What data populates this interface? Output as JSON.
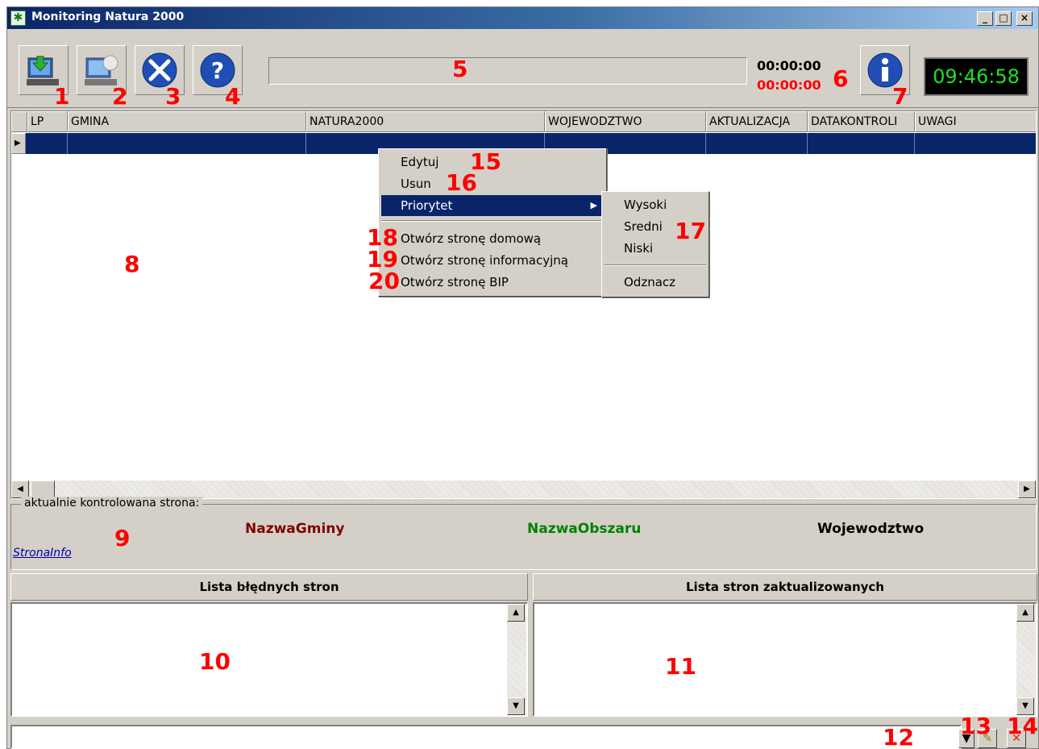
{
  "window": {
    "title": "Monitoring Natura 2000",
    "app_icon": "asterisk-icon",
    "minimize": "_",
    "maximize": "□",
    "close": "×"
  },
  "toolbar": {
    "buttons": [
      {
        "icon": "download-computer-icon",
        "marker": "1"
      },
      {
        "icon": "computer-monitor-icon",
        "marker": "2"
      },
      {
        "icon": "tools-wrench-icon",
        "marker": "3"
      },
      {
        "icon": "help-question-icon",
        "marker": "4"
      }
    ],
    "progress_marker": "5",
    "timer_elapsed": "00:00:00",
    "timer_remaining": "00:00:00",
    "timer_marker": "6",
    "info_button": {
      "icon": "info-icon",
      "marker": "7"
    },
    "clock": "09:46:58",
    "clock_color": "#21e021"
  },
  "grid": {
    "marker": "8",
    "columns": [
      "LP",
      "GMINA",
      "NATURA2000",
      "WOJEWODZTWO",
      "AKTUALIZACJA",
      "DATAKONTROLI",
      "UWAGI"
    ],
    "selected_row_color": "#0a246a",
    "row_indicator": "▶"
  },
  "context_menu": {
    "items": [
      {
        "label": "Edytuj",
        "marker": "15"
      },
      {
        "label": "Usun",
        "marker": "16"
      },
      {
        "label": "Priorytet",
        "marker": ""
      },
      {
        "label": "Otwórz stronę domową",
        "marker": "18"
      },
      {
        "label": "Otwórz stronę informacyjną",
        "marker": "19"
      },
      {
        "label": "Otwórz stronę BIP",
        "marker": "20"
      }
    ],
    "submenu": {
      "items": [
        "Wysoki",
        "Sredni",
        "Niski",
        "Odznacz"
      ],
      "marker": "17"
    }
  },
  "current_site": {
    "legend": "aktualnie kontrolowana strona:",
    "marker": "9",
    "gmina": "NazwaGminy",
    "gmina_color": "#800000",
    "obszar": "NazwaObszaru",
    "obszar_color": "#008000",
    "wojewodztwo": "Wojewodztwo",
    "link": "StronaInfo"
  },
  "lists": {
    "errors_title": "Lista błędnych stron",
    "errors_marker": "10",
    "updated_title": "Lista stron zaktualizowanych",
    "updated_marker": "11"
  },
  "statusbar": {
    "field_marker": "12",
    "dropdown_icon": "dropdown-arrow-icon",
    "edit_marker": "13",
    "edit_icon": "pencil-icon",
    "clear_marker": "14",
    "clear_icon": "red-x-icon"
  }
}
